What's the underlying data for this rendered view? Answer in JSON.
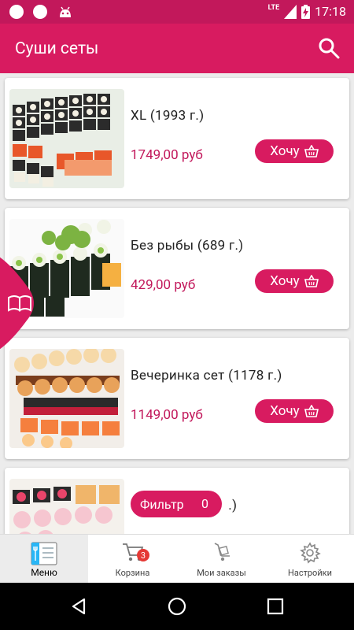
{
  "status": {
    "time": "17:18",
    "network": "LTE"
  },
  "appbar": {
    "title": "Суши сеты"
  },
  "items": [
    {
      "name": "XL (1993 г.)",
      "price": "1749,00 руб",
      "button": "Хочу"
    },
    {
      "name": "Без рыбы (689 г.)",
      "price": "429,00 руб",
      "button": "Хочу"
    },
    {
      "name": "Вечеринка сет (1178 г.)",
      "price": "1149,00 руб",
      "button": "Хочу"
    },
    {
      "name": "Г",
      "name_suffix": ".)",
      "price": "",
      "button": ""
    }
  ],
  "filter": {
    "label": "Фильтр",
    "count": "0"
  },
  "bottom_nav": [
    {
      "label": "Меню",
      "icon": "menu-icon",
      "active": true
    },
    {
      "label": "Корзина",
      "icon": "cart-icon",
      "badge": "3"
    },
    {
      "label": "Мои заказы",
      "icon": "orders-icon"
    },
    {
      "label": "Настройки",
      "icon": "settings-icon"
    }
  ],
  "colors": {
    "primary": "#d81b60",
    "status": "#c2185b",
    "price": "#c2185b"
  }
}
